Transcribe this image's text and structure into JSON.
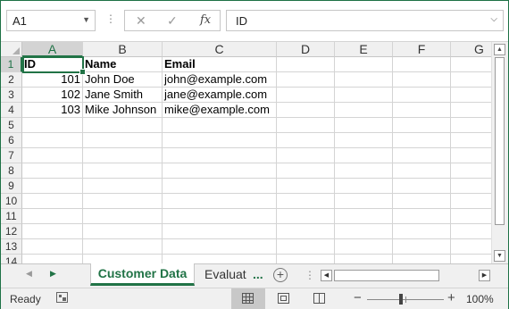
{
  "formula_bar": {
    "name_box": "A1",
    "cancel_glyph": "✕",
    "enter_glyph": "✓",
    "fx_label": "fx",
    "formula_value": "ID"
  },
  "columns": [
    "A",
    "B",
    "C",
    "D",
    "E",
    "F",
    "G"
  ],
  "rows": [
    "1",
    "2",
    "3",
    "4",
    "5",
    "6",
    "7",
    "8",
    "9",
    "10",
    "11",
    "12",
    "13",
    "14"
  ],
  "cells": {
    "A1": "ID",
    "B1": "Name",
    "C1": "Email",
    "A2": "101",
    "B2": "John Doe",
    "C2": "john@example.com",
    "A3": "102",
    "B3": "Jane Smith",
    "C3": "jane@example.com",
    "A4": "103",
    "B4": "Mike Johnson",
    "C4": "mike@example.com"
  },
  "sheet_tabs": {
    "active": "Customer Data",
    "second": "Evaluat",
    "more": "...",
    "add": "+"
  },
  "status_bar": {
    "ready": "Ready",
    "zoom_minus": "−",
    "zoom_plus": "+",
    "zoom_level": "100%"
  },
  "colors": {
    "accent": "#217346",
    "frame": "#1e7145"
  }
}
